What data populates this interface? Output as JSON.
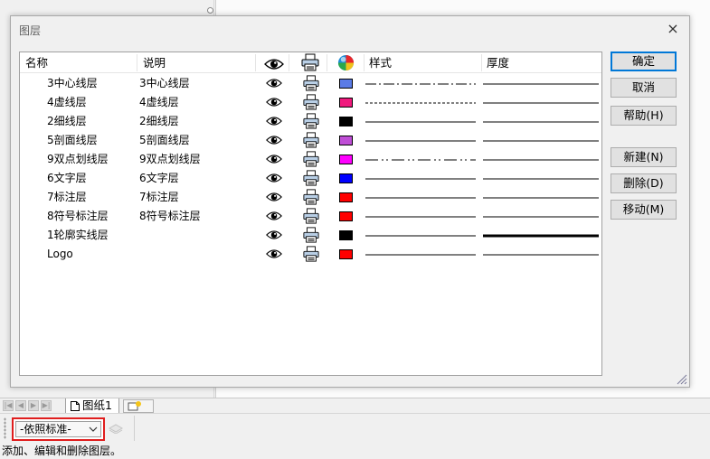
{
  "dialog": {
    "title": "图层",
    "close_glyph": "×",
    "columns": {
      "name": "名称",
      "description": "说明",
      "visible_icon": "eye-icon",
      "print_icon": "printer-icon",
      "color_icon": "color-wheel-icon",
      "linetype": "样式",
      "thickness": "厚度"
    },
    "layers": [
      {
        "name": "3中心线层",
        "description": "3中心线层",
        "color": "#5b7be6",
        "linetype": "center",
        "thickness": "thin"
      },
      {
        "name": "4虚线层",
        "description": "4虚线层",
        "color": "#f0197d",
        "linetype": "dashed",
        "thickness": "thin"
      },
      {
        "name": "2细线层",
        "description": "2细线层",
        "color": "#000000",
        "linetype": "solid",
        "thickness": "thin"
      },
      {
        "name": "5剖面线层",
        "description": "5剖面线层",
        "color": "#bf4ed6",
        "linetype": "solid",
        "thickness": "thin"
      },
      {
        "name": "9双点划线层",
        "description": "9双点划线层",
        "color": "#ff00ff",
        "linetype": "double-dot-dash",
        "thickness": "thin"
      },
      {
        "name": "6文字层",
        "description": "6文字层",
        "color": "#0000ff",
        "linetype": "solid",
        "thickness": "thin"
      },
      {
        "name": "7标注层",
        "description": "7标注层",
        "color": "#ff0000",
        "linetype": "solid",
        "thickness": "thin"
      },
      {
        "name": "8符号标注层",
        "description": "8符号标注层",
        "color": "#ff0000",
        "linetype": "solid",
        "thickness": "thin"
      },
      {
        "name": "1轮廓实线层",
        "description": "",
        "color": "#000000",
        "linetype": "solid",
        "thickness": "thick"
      },
      {
        "name": "Logo",
        "description": "",
        "color": "#ff0000",
        "linetype": "solid",
        "thickness": "thin"
      }
    ],
    "buttons": {
      "ok": "确定",
      "cancel": "取消",
      "help": "帮助(H)",
      "new": "新建(N)",
      "delete": "删除(D)",
      "move": "移动(M)"
    }
  },
  "tabs": {
    "sheet_label": "图纸1",
    "new_tab_icon": "new-sheet-icon"
  },
  "toolbar": {
    "layer_combo_value": "-依照标准-"
  },
  "statusbar": {
    "text": "添加、编辑和删除图层。"
  }
}
